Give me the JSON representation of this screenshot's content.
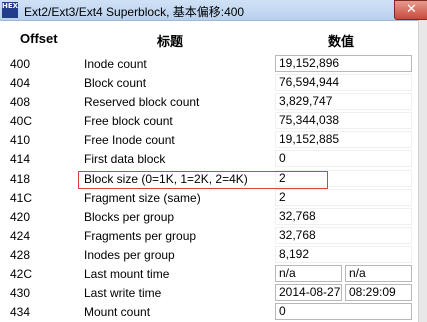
{
  "window": {
    "title": "Ext2/Ext3/Ext4 Superblock, 基本偏移:400",
    "icon_text": "HEX",
    "close_label": "✕"
  },
  "table": {
    "headers": {
      "offset": "Offset",
      "title": "标题",
      "value": "数值"
    },
    "rows": [
      {
        "offset": "400",
        "label": "Inode count",
        "value": "19,152,896"
      },
      {
        "offset": "404",
        "label": "Block count",
        "value": "76,594,944"
      },
      {
        "offset": "408",
        "label": "Reserved block count",
        "value": "3,829,747"
      },
      {
        "offset": "40C",
        "label": "Free block count",
        "value": "75,344,038"
      },
      {
        "offset": "410",
        "label": "Free Inode count",
        "value": "19,152,885"
      },
      {
        "offset": "414",
        "label": "First data block",
        "value": "0"
      },
      {
        "offset": "418",
        "label": "Block size (0=1K, 1=2K, 2=4K)",
        "value": "2"
      },
      {
        "offset": "41C",
        "label": "Fragment size (same)",
        "value": "2"
      },
      {
        "offset": "420",
        "label": "Blocks per group",
        "value": "32,768"
      },
      {
        "offset": "424",
        "label": "Fragments per group",
        "value": "32,768"
      },
      {
        "offset": "428",
        "label": "Inodes per group",
        "value": "8,192"
      },
      {
        "offset": "42C",
        "label": "Last mount time",
        "value": "n/a",
        "value2": "n/a"
      },
      {
        "offset": "430",
        "label": "Last write time",
        "value": "2014-08-2​7",
        "value2": "08:29:09"
      },
      {
        "offset": "434",
        "label": "Mount count",
        "value": "0"
      }
    ]
  }
}
